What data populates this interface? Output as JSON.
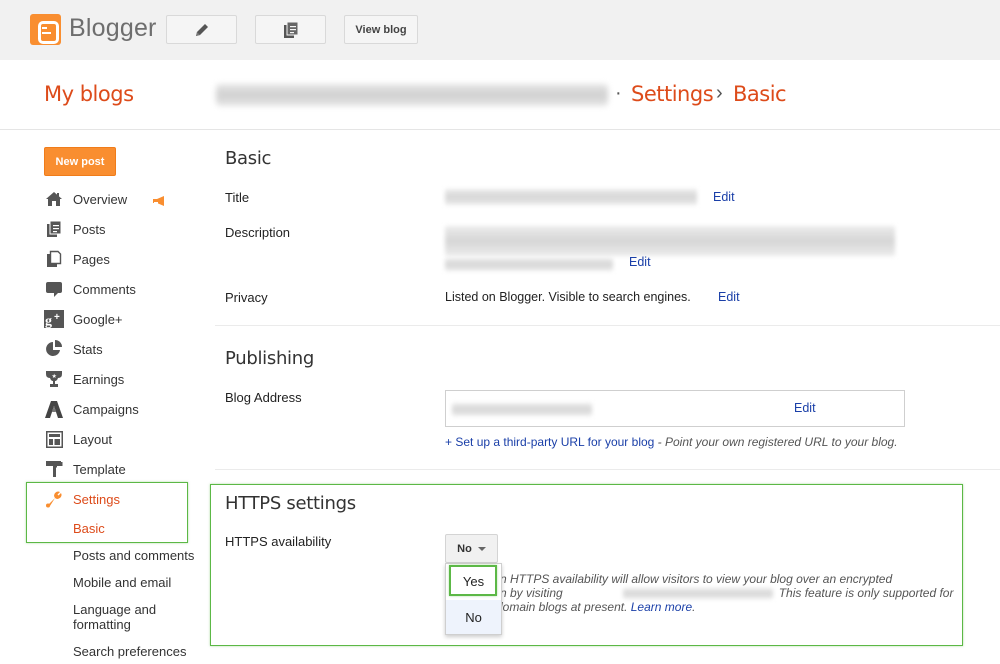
{
  "topbar": {
    "brand": "Blogger",
    "view_blog_label": "View blog",
    "icons": [
      "pencil-icon",
      "pages-icon"
    ]
  },
  "header": {
    "my_blogs": "My blogs",
    "breadcrumb": {
      "separator_dot": "·",
      "settings": "Settings",
      "separator_arrow": "›",
      "current": "Basic"
    }
  },
  "sidebar": {
    "new_post_label": "New post",
    "items": [
      {
        "label": "Overview",
        "icon": "home-icon"
      },
      {
        "label": "Posts",
        "icon": "posts-icon"
      },
      {
        "label": "Pages",
        "icon": "pages-icon"
      },
      {
        "label": "Comments",
        "icon": "comment-icon"
      },
      {
        "label": "Google+",
        "icon": "google-plus-icon"
      },
      {
        "label": "Stats",
        "icon": "pie-chart-icon"
      },
      {
        "label": "Earnings",
        "icon": "trophy-icon"
      },
      {
        "label": "Campaigns",
        "icon": "campaigns-icon"
      },
      {
        "label": "Layout",
        "icon": "layout-icon"
      },
      {
        "label": "Template",
        "icon": "paint-roller-icon"
      },
      {
        "label": "Settings",
        "icon": "wrench-icon",
        "active": true
      }
    ],
    "settings_sub": [
      {
        "label": "Basic",
        "active": true
      },
      {
        "label": "Posts and comments"
      },
      {
        "label": "Mobile and email"
      },
      {
        "label": "Language and formatting"
      },
      {
        "label": "Search preferences"
      }
    ]
  },
  "main": {
    "basic": {
      "title": "Basic",
      "title_label": "Title",
      "description_label": "Description",
      "privacy_label": "Privacy",
      "privacy_value": "Listed on Blogger. Visible to search engines.",
      "edit_label": "Edit"
    },
    "publishing": {
      "title": "Publishing",
      "blog_address_label": "Blog Address",
      "edit_label": "Edit",
      "third_party_link": "+ Set up a third-party URL for your blog",
      "third_party_desc": " - Point your own registered URL to your blog."
    },
    "https": {
      "title": "HTTPS settings",
      "availability_label": "HTTPS availability",
      "selected_value": "No",
      "options": [
        "Yes",
        "No"
      ],
      "description_line1": "n HTTPS availability will allow visitors to view your blog over an encrypted",
      "description_line2_a": "n by visiting",
      "description_line2_b": "This feature is only supported for",
      "description_line3": "lomain blogs at present. ",
      "learn_more": "Learn more",
      "description_end": "."
    }
  },
  "colors": {
    "accent_orange": "#dd4b1a",
    "button_orange": "#f98e30",
    "link_blue": "#1a3fa8",
    "highlight_green": "#5cb846"
  }
}
